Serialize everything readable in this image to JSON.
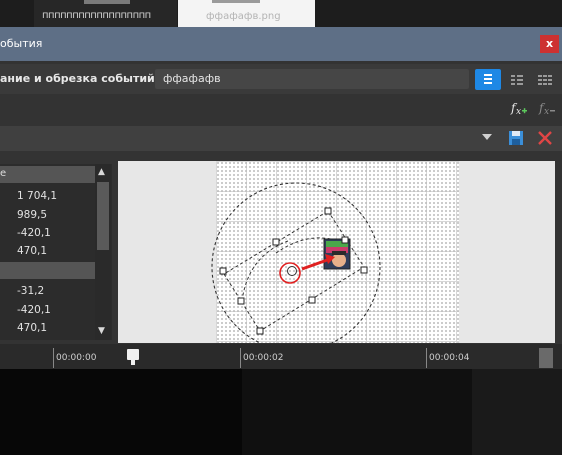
{
  "tabs": {
    "left_label": "пппппппппппппппппп",
    "right_label": "ффафафв.png"
  },
  "window": {
    "title": "обытия",
    "close_label": "x"
  },
  "pan_crop": {
    "label": "ание и обрезка событий:",
    "event_name": "ффафафв"
  },
  "properties": {
    "group1_header": "е",
    "group1_values": [
      "1 704,1",
      "989,5",
      "-420,1",
      "470,1"
    ],
    "group2_values": [
      "-31,2",
      "-420,1",
      "470,1"
    ]
  },
  "timeline": {
    "ticks": [
      "00:00:00",
      "00:00:02",
      "00:00:04"
    ]
  },
  "icons": {
    "fx_add": "fx-add-icon",
    "fx_remove": "fx-remove-icon",
    "save": "save-icon",
    "delete": "delete-icon",
    "view_modes": [
      "view-list-icon",
      "view-compact-icon",
      "view-grid-icon"
    ]
  },
  "colors": {
    "titlebar": "#5e6f86",
    "accent": "#1e88e5",
    "close": "#cd3131",
    "delete": "#e04545",
    "path_arrow": "#e02020"
  }
}
